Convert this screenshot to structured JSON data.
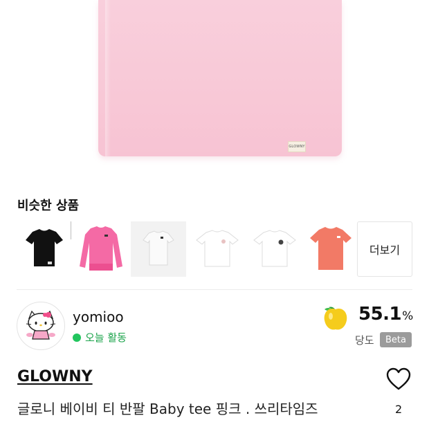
{
  "similar": {
    "title": "비슷한 상품",
    "more_label": "더보기",
    "items": [
      {
        "name": "black-tee",
        "color": "#111111"
      },
      {
        "name": "pink-longsleeve",
        "color": "#f46aa5"
      },
      {
        "name": "white-tee-gray-bg",
        "color": "#ffffff"
      },
      {
        "name": "white-tee-print",
        "color": "#ffffff"
      },
      {
        "name": "white-tee-logo",
        "color": "#ffffff"
      },
      {
        "name": "coral-tee",
        "color": "#f27a66"
      }
    ]
  },
  "seller": {
    "name": "yomioo",
    "activity": "오늘 활동",
    "activity_color": "#22c55e",
    "avatar_icon": "hello-kitty-avatar-icon"
  },
  "sweetness": {
    "value": "55.1",
    "unit": "%",
    "label": "당도",
    "badge": "Beta",
    "icon": "yellow-apple-icon"
  },
  "product": {
    "brand": "GLOWNY",
    "title": "글로니 베이비 티 반팔 Baby tee 핑크 . 쓰리타임즈",
    "likes": "2",
    "color": "#f8c9d7"
  }
}
